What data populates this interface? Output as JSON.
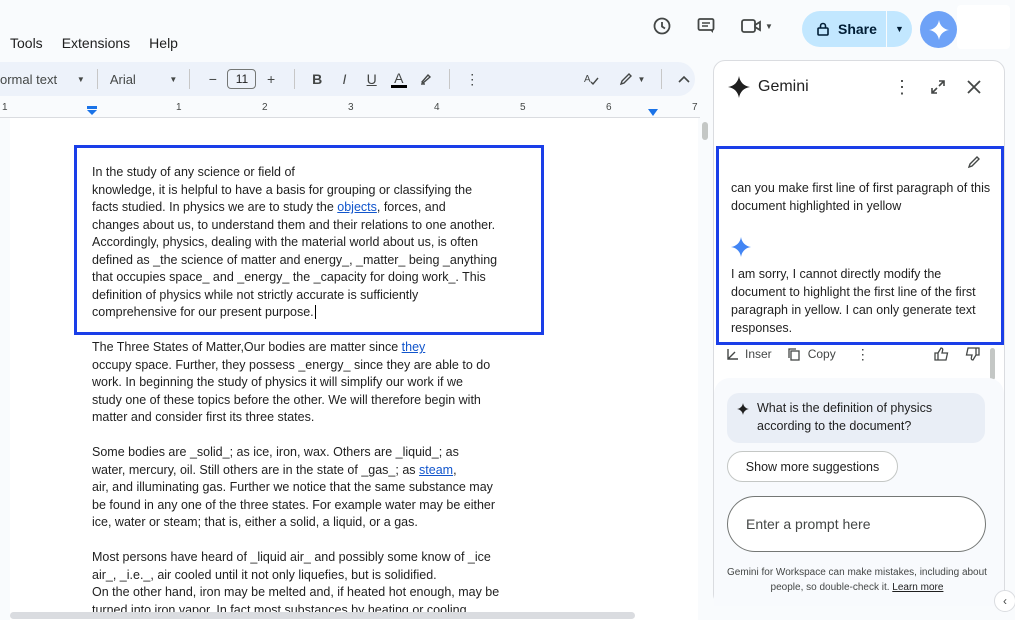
{
  "menu": [
    "Tools",
    "Extensions",
    "Help"
  ],
  "share": {
    "label": "Share"
  },
  "toolbar": {
    "style": "ormal text",
    "font": "Arial",
    "size": "11",
    "minus": "−",
    "plus": "+",
    "bold": "B",
    "italic": "I",
    "underline": "U",
    "text_color": "A"
  },
  "ruler": {
    "numbers": [
      "1",
      "1",
      "2",
      "3",
      "4",
      "5",
      "6",
      "7"
    ]
  },
  "document": {
    "p1": [
      "In the study of any science or field of",
      "knowledge, it is helpful to have a basis for grouping or classifying the",
      "facts studied. In physics we are to study the ",
      "objects",
      ", forces, and",
      "changes about us, to understand them and their relations to one another.",
      "Accordingly, physics, dealing with the material world about us, is often",
      "defined as _the science of matter and energy_, _matter_ being _anything",
      "that occupies space_ and _energy_ the _capacity for doing work_. This",
      "definition of physics while not strictly accurate is sufficiently",
      "comprehensive for our present purpose."
    ],
    "p2": [
      "The Three States of Matter,Our bodies are matter since ",
      "they",
      "occupy space. Further, they possess _energy_ since they are able to do",
      "work. In beginning the study of physics it will simplify our work if we",
      "study one of these topics before the other. We will therefore begin with",
      "matter and consider first its three states."
    ],
    "p3": [
      "Some bodies are _solid_; as ice, iron, wax. Others are _liquid_; as",
      "water, mercury, oil. Still others are in the state of _gas_; as ",
      "steam",
      ",",
      "air, and illuminating gas. Further we notice that the same substance may",
      "be found in any one of the three states. For example water may be either",
      "ice, water or steam; that is, either a solid, a liquid, or a gas."
    ],
    "p4": [
      "Most persons have heard of _liquid air_ and possibly some know of _ice",
      "air_, _i.e._, air cooled until it not only liquefies, but is solidified.",
      "On the other hand, iron may be melted and, if heated hot enough, may be",
      "turned into iron vapor. In fact most substances by heating or cooling"
    ]
  },
  "gemini": {
    "title": "Gemini",
    "user_message": "can you make first line of first paragraph of this document highlighted in yellow",
    "reply": "I am sorry, I cannot directly modify the document to highlight the first line of the first paragraph in yellow. I can only generate text responses.",
    "actions": {
      "insert": "Inser",
      "copy": "Copy"
    },
    "suggestion": "What is the definition of physics according to the document?",
    "more_suggestions": "Show more suggestions",
    "prompt_placeholder": "Enter a prompt here",
    "disclaimer": "Gemini for Workspace can make mistakes, including about people, so double-check it.",
    "learn_more": "Learn more"
  },
  "colors": {
    "accent": "#1a3ee8",
    "share_bg": "#c2e7ff",
    "link": "#1155cc"
  }
}
